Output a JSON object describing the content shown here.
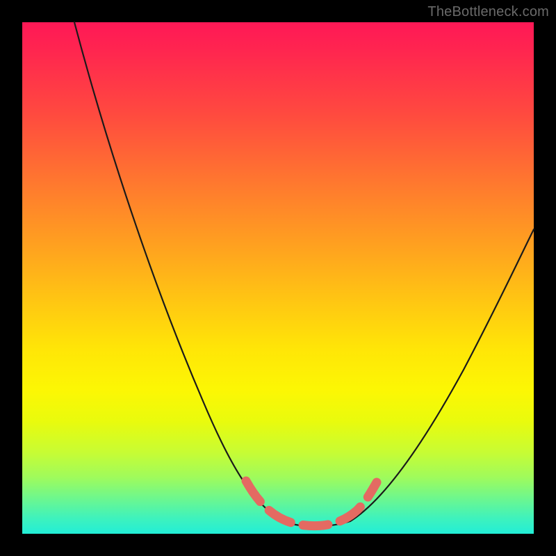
{
  "watermark": "TheBottleneck.com",
  "chart_data": {
    "type": "line",
    "title": "",
    "xlabel": "",
    "ylabel": "",
    "xlim": [
      0,
      100
    ],
    "ylim": [
      0,
      100
    ],
    "grid": false,
    "legend": false,
    "series": [
      {
        "name": "bottleneck-curve",
        "x": [
          10,
          15,
          20,
          25,
          30,
          35,
          40,
          45,
          50,
          55,
          60,
          65,
          70,
          75,
          80,
          85,
          90,
          95,
          100
        ],
        "values": [
          100,
          88,
          75,
          63,
          50,
          38,
          26,
          15,
          6,
          1,
          0,
          2,
          8,
          16,
          25,
          34,
          43,
          51,
          58
        ]
      }
    ],
    "annotations": [
      {
        "name": "optimal-range-marker",
        "x_start": 44,
        "x_end": 67,
        "y": 3
      }
    ],
    "colors": {
      "gradient_top": "#ff1856",
      "gradient_mid": "#ffe607",
      "gradient_bottom": "#22eed7",
      "curve": "#1a1a1a",
      "marker": "#e46a62",
      "frame": "#000000"
    }
  }
}
